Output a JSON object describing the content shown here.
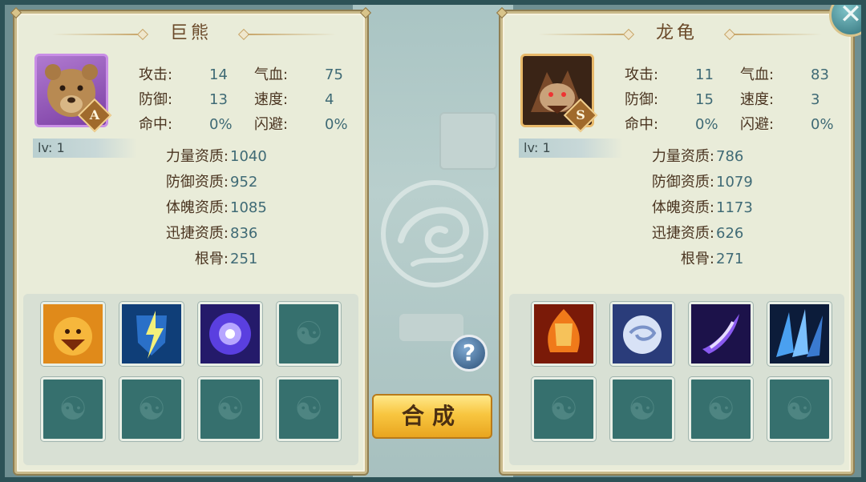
{
  "close_label": "✕",
  "help_label": "?",
  "merge_label": "合成",
  "left": {
    "name": "巨熊",
    "grade": "A",
    "level": "lv: 1",
    "stats": {
      "attack_k": "攻击:",
      "attack_v": "14",
      "hp_k": "气血:",
      "hp_v": "75",
      "defense_k": "防御:",
      "defense_v": "13",
      "speed_k": "速度:",
      "speed_v": "4",
      "hit_k": "命中:",
      "hit_v": "0%",
      "dodge_k": "闪避:",
      "dodge_v": "0%"
    },
    "aptitudes": {
      "strength_k": "力量资质:",
      "strength_v": "1040",
      "defense_k": "防御资质:",
      "defense_v": "952",
      "physique_k": "体魄资质:",
      "physique_v": "1085",
      "agility_k": "迅捷资质:",
      "agility_v": "836",
      "bone_k": "根骨:",
      "bone_v": "251"
    },
    "skills": [
      "lion-roar-icon",
      "lightning-shield-icon",
      "purple-orb-icon",
      "empty",
      "empty",
      "empty",
      "empty",
      "empty"
    ]
  },
  "right": {
    "name": "龙龟",
    "grade": "S",
    "level": "lv: 1",
    "stats": {
      "attack_k": "攻击:",
      "attack_v": "11",
      "hp_k": "气血:",
      "hp_v": "83",
      "defense_k": "防御:",
      "defense_v": "15",
      "speed_k": "速度:",
      "speed_v": "3",
      "hit_k": "命中:",
      "hit_v": "0%",
      "dodge_k": "闪避:",
      "dodge_v": "0%"
    },
    "aptitudes": {
      "strength_k": "力量资质:",
      "strength_v": "786",
      "defense_k": "防御资质:",
      "defense_v": "1079",
      "physique_k": "体魄资质:",
      "physique_v": "1173",
      "agility_k": "迅捷资质:",
      "agility_v": "626",
      "bone_k": "根骨:",
      "bone_v": "271"
    },
    "skills": [
      "fire-shield-icon",
      "wind-orb-icon",
      "purple-slash-icon",
      "ice-shards-icon",
      "empty",
      "empty",
      "empty",
      "empty"
    ]
  }
}
